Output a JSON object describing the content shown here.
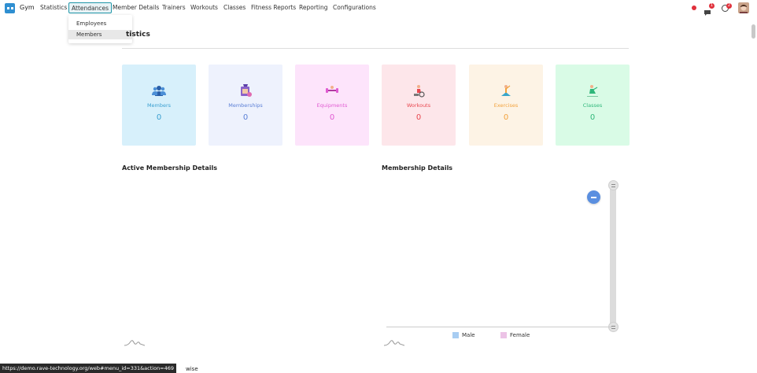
{
  "navbar": {
    "app_name": "Gym",
    "items": [
      "Statistics",
      "Attendances",
      "Member Details",
      "Trainers",
      "Workouts",
      "Classes",
      "Fitness Reports",
      "Reporting",
      "Configurations"
    ],
    "chat_badge": "1",
    "activity_badge": "2"
  },
  "dropdown": {
    "items": [
      "Employees",
      "Members"
    ]
  },
  "page": {
    "title_visible": "tistics"
  },
  "cards": [
    {
      "label": "Members",
      "value": "0",
      "bg": "#d7f0fb",
      "color": "#3a9fd0"
    },
    {
      "label": "Memberships",
      "value": "0",
      "bg": "#eef2fd",
      "color": "#5b7fd6"
    },
    {
      "label": "Equipments",
      "value": "0",
      "bg": "#fde4fb",
      "color": "#e05ad2"
    },
    {
      "label": "Workouts",
      "value": "0",
      "bg": "#fde6ea",
      "color": "#e8474f"
    },
    {
      "label": "Exercises",
      "value": "0",
      "bg": "#fdf3e5",
      "color": "#f2a23c"
    },
    {
      "label": "Classes",
      "value": "0",
      "bg": "#d9fbe6",
      "color": "#2fb77a"
    }
  ],
  "sections": {
    "active_membership": "Active Membership Details",
    "membership": "Membership Details"
  },
  "legend": [
    {
      "label": "Male",
      "color": "#a8cdf2"
    },
    {
      "label": "Female",
      "color": "#ecc3e6"
    }
  ],
  "status_bar": {
    "url": "https://demo.rave-technology.org/web#menu_id=331&action=469",
    "partial": "wise"
  }
}
